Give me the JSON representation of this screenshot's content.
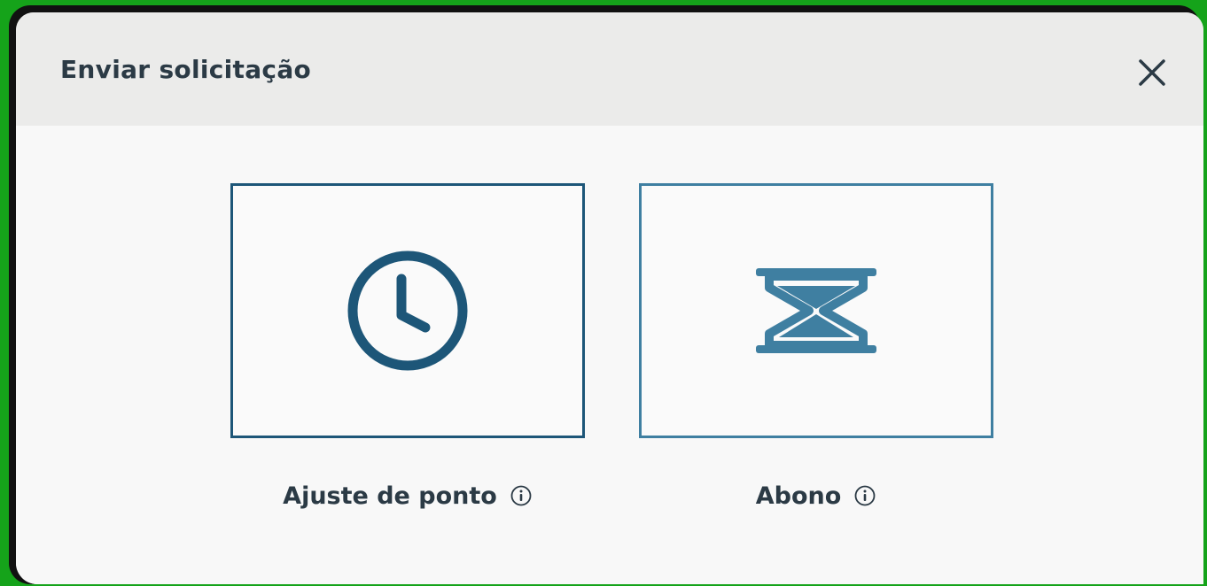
{
  "dialog": {
    "title": "Enviar solicitação",
    "close_icon": "close-icon"
  },
  "options": [
    {
      "label": "Ajuste de ponto",
      "icon": "clock-icon",
      "info_icon": "info-icon"
    },
    {
      "label": "Abono",
      "icon": "hourglass-icon",
      "info_icon": "info-icon"
    }
  ],
  "colors": {
    "frame_green": "#15a31a",
    "header_bg": "#ebebea",
    "primary_blue": "#1d5678",
    "secondary_blue": "#3f7fa1",
    "text_dark": "#2b3a45"
  }
}
